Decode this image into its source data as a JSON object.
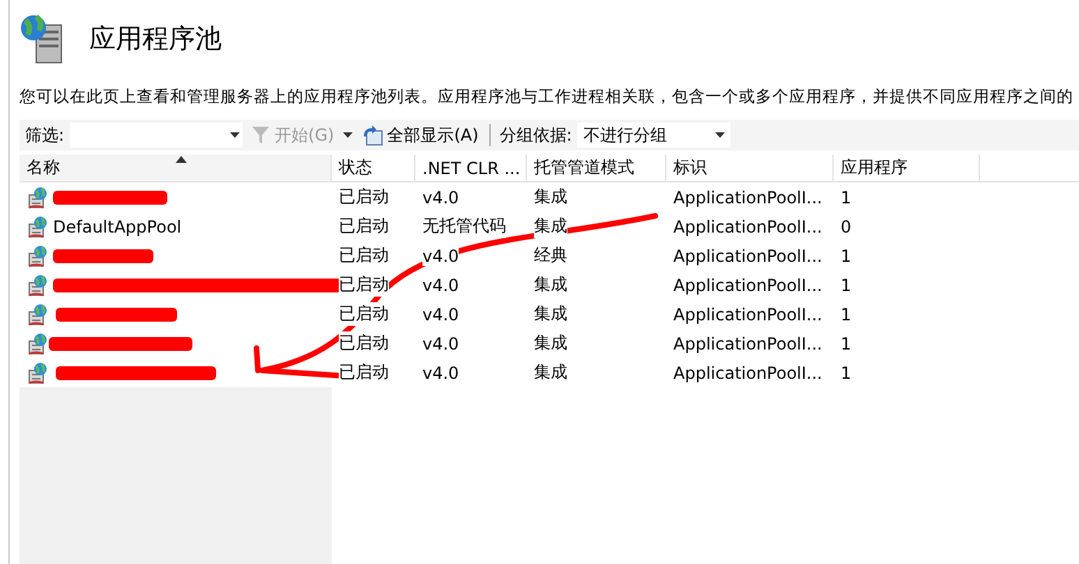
{
  "page": {
    "title": "应用程序池",
    "description": "您可以在此页上查看和管理服务器上的应用程序池列表。应用程序池与工作进程相关联，包含一个或多个应用程序，并提供不同应用程序之间的"
  },
  "toolbar": {
    "filter_label": "筛选:",
    "start_button": {
      "label": "开始(G)",
      "disabled": true
    },
    "show_all_button": "全部显示(A)",
    "group_label": "分组依据:",
    "group_value": "不进行分组"
  },
  "table": {
    "columns": [
      {
        "label": "名称",
        "sorted": true
      },
      {
        "label": "状态",
        "sorted": false
      },
      {
        "label": ".NET CLR ...",
        "sorted": false
      },
      {
        "label": "托管管道模式",
        "sorted": false
      },
      {
        "label": "标识",
        "sorted": false
      },
      {
        "label": "应用程序",
        "sorted": false
      }
    ],
    "rows": [
      {
        "redacted": true,
        "status": "已启动",
        "clr": "v4.0",
        "pipeline": "集成",
        "identity": "ApplicationPoolI...",
        "apps": "1"
      },
      {
        "redacted": false,
        "name": "DefaultAppPool",
        "status": "已启动",
        "clr": "无托管代码",
        "pipeline": "集成",
        "identity": "ApplicationPoolI...",
        "apps": "0"
      },
      {
        "redacted": true,
        "status": "已启动",
        "clr": "v4.0",
        "pipeline": "经典",
        "identity": "ApplicationPoolI...",
        "apps": "1"
      },
      {
        "redacted": true,
        "status": "已启动",
        "clr": "v4.0",
        "pipeline": "集成",
        "identity": "ApplicationPoolI...",
        "apps": "1"
      },
      {
        "redacted": true,
        "status": "已启动",
        "clr": "v4.0",
        "pipeline": "集成",
        "identity": "ApplicationPoolI...",
        "apps": "1"
      },
      {
        "redacted": true,
        "status": "已启动",
        "clr": "v4.0",
        "pipeline": "集成",
        "identity": "ApplicationPoolI...",
        "apps": "1"
      },
      {
        "redacted": true,
        "status": "已启动",
        "clr": "v4.0",
        "pipeline": "集成",
        "identity": "ApplicationPoolI...",
        "apps": "1"
      }
    ]
  }
}
